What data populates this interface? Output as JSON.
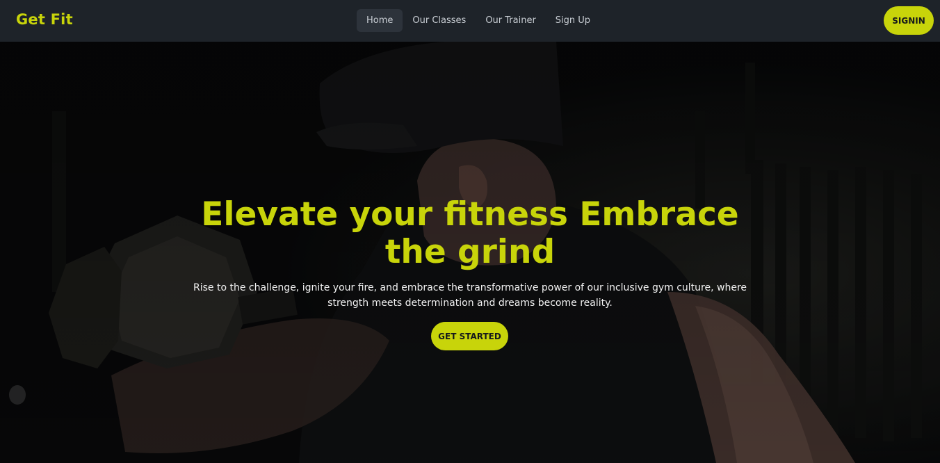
{
  "brand": "Get Fit",
  "nav": {
    "items": [
      {
        "label": "Home",
        "active": true
      },
      {
        "label": "Our Classes",
        "active": false
      },
      {
        "label": "Our Trainer",
        "active": false
      },
      {
        "label": "Sign Up",
        "active": false
      }
    ],
    "signin_label": "SIGNIN"
  },
  "hero": {
    "title": "Elevate your fitness Embrace the grind",
    "text": "Rise to the challenge, ignite your fire, and embrace the transformative power of our inclusive gym culture, where strength meets determination and dreams become reality.",
    "cta_label": "GET STARTED",
    "background_image": "dark-gym-dumbbell-photo"
  },
  "colors": {
    "accent": "#c8d40a",
    "navbar_bg": "#1e2329",
    "active_tab_bg": "#2d333b",
    "hero_text": "#f2f2f2"
  }
}
